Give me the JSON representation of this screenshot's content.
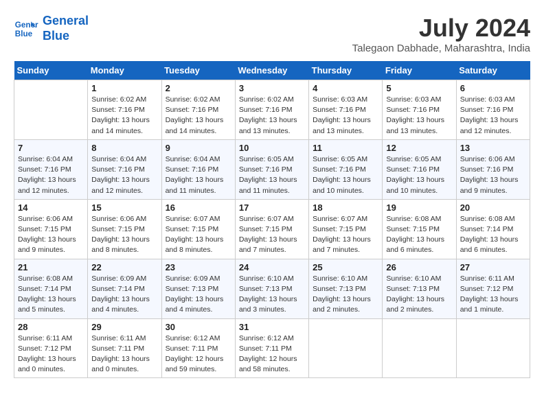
{
  "logo": {
    "line1": "General",
    "line2": "Blue"
  },
  "title": "July 2024",
  "location": "Talegaon Dabhade, Maharashtra, India",
  "days_of_week": [
    "Sunday",
    "Monday",
    "Tuesday",
    "Wednesday",
    "Thursday",
    "Friday",
    "Saturday"
  ],
  "weeks": [
    [
      null,
      {
        "day": 1,
        "sunrise": "6:02 AM",
        "sunset": "7:16 PM",
        "daylight": "13 hours and 14 minutes."
      },
      {
        "day": 2,
        "sunrise": "6:02 AM",
        "sunset": "7:16 PM",
        "daylight": "13 hours and 14 minutes."
      },
      {
        "day": 3,
        "sunrise": "6:02 AM",
        "sunset": "7:16 PM",
        "daylight": "13 hours and 13 minutes."
      },
      {
        "day": 4,
        "sunrise": "6:03 AM",
        "sunset": "7:16 PM",
        "daylight": "13 hours and 13 minutes."
      },
      {
        "day": 5,
        "sunrise": "6:03 AM",
        "sunset": "7:16 PM",
        "daylight": "13 hours and 13 minutes."
      },
      {
        "day": 6,
        "sunrise": "6:03 AM",
        "sunset": "7:16 PM",
        "daylight": "13 hours and 12 minutes."
      }
    ],
    [
      {
        "day": 7,
        "sunrise": "6:04 AM",
        "sunset": "7:16 PM",
        "daylight": "13 hours and 12 minutes."
      },
      {
        "day": 8,
        "sunrise": "6:04 AM",
        "sunset": "7:16 PM",
        "daylight": "13 hours and 12 minutes."
      },
      {
        "day": 9,
        "sunrise": "6:04 AM",
        "sunset": "7:16 PM",
        "daylight": "13 hours and 11 minutes."
      },
      {
        "day": 10,
        "sunrise": "6:05 AM",
        "sunset": "7:16 PM",
        "daylight": "13 hours and 11 minutes."
      },
      {
        "day": 11,
        "sunrise": "6:05 AM",
        "sunset": "7:16 PM",
        "daylight": "13 hours and 10 minutes."
      },
      {
        "day": 12,
        "sunrise": "6:05 AM",
        "sunset": "7:16 PM",
        "daylight": "13 hours and 10 minutes."
      },
      {
        "day": 13,
        "sunrise": "6:06 AM",
        "sunset": "7:16 PM",
        "daylight": "13 hours and 9 minutes."
      }
    ],
    [
      {
        "day": 14,
        "sunrise": "6:06 AM",
        "sunset": "7:15 PM",
        "daylight": "13 hours and 9 minutes."
      },
      {
        "day": 15,
        "sunrise": "6:06 AM",
        "sunset": "7:15 PM",
        "daylight": "13 hours and 8 minutes."
      },
      {
        "day": 16,
        "sunrise": "6:07 AM",
        "sunset": "7:15 PM",
        "daylight": "13 hours and 8 minutes."
      },
      {
        "day": 17,
        "sunrise": "6:07 AM",
        "sunset": "7:15 PM",
        "daylight": "13 hours and 7 minutes."
      },
      {
        "day": 18,
        "sunrise": "6:07 AM",
        "sunset": "7:15 PM",
        "daylight": "13 hours and 7 minutes."
      },
      {
        "day": 19,
        "sunrise": "6:08 AM",
        "sunset": "7:15 PM",
        "daylight": "13 hours and 6 minutes."
      },
      {
        "day": 20,
        "sunrise": "6:08 AM",
        "sunset": "7:14 PM",
        "daylight": "13 hours and 6 minutes."
      }
    ],
    [
      {
        "day": 21,
        "sunrise": "6:08 AM",
        "sunset": "7:14 PM",
        "daylight": "13 hours and 5 minutes."
      },
      {
        "day": 22,
        "sunrise": "6:09 AM",
        "sunset": "7:14 PM",
        "daylight": "13 hours and 4 minutes."
      },
      {
        "day": 23,
        "sunrise": "6:09 AM",
        "sunset": "7:13 PM",
        "daylight": "13 hours and 4 minutes."
      },
      {
        "day": 24,
        "sunrise": "6:10 AM",
        "sunset": "7:13 PM",
        "daylight": "13 hours and 3 minutes."
      },
      {
        "day": 25,
        "sunrise": "6:10 AM",
        "sunset": "7:13 PM",
        "daylight": "13 hours and 2 minutes."
      },
      {
        "day": 26,
        "sunrise": "6:10 AM",
        "sunset": "7:13 PM",
        "daylight": "13 hours and 2 minutes."
      },
      {
        "day": 27,
        "sunrise": "6:11 AM",
        "sunset": "7:12 PM",
        "daylight": "13 hours and 1 minute."
      }
    ],
    [
      {
        "day": 28,
        "sunrise": "6:11 AM",
        "sunset": "7:12 PM",
        "daylight": "13 hours and 0 minutes."
      },
      {
        "day": 29,
        "sunrise": "6:11 AM",
        "sunset": "7:11 PM",
        "daylight": "13 hours and 0 minutes."
      },
      {
        "day": 30,
        "sunrise": "6:12 AM",
        "sunset": "7:11 PM",
        "daylight": "12 hours and 59 minutes."
      },
      {
        "day": 31,
        "sunrise": "6:12 AM",
        "sunset": "7:11 PM",
        "daylight": "12 hours and 58 minutes."
      },
      null,
      null,
      null
    ]
  ]
}
